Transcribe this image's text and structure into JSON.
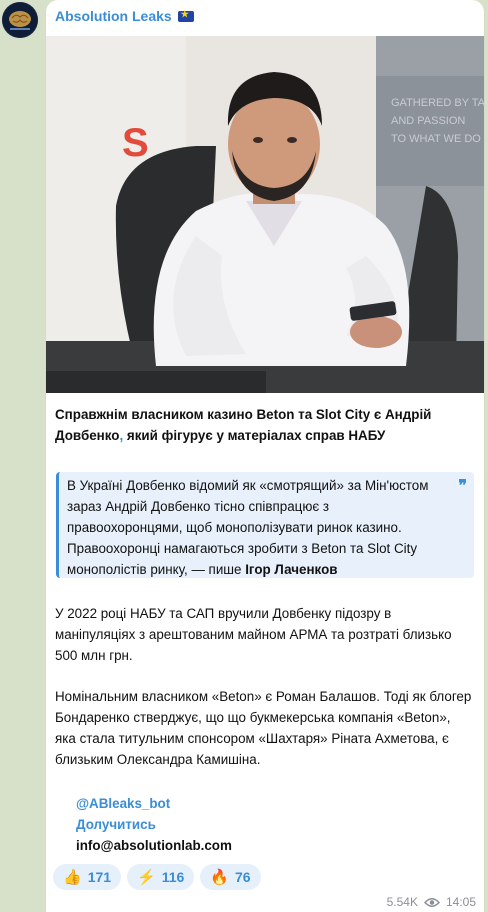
{
  "channel": {
    "name": "Absolution Leaks",
    "flag_icon": "eu-flag-icon",
    "avatar_icon": "brain-logo-icon"
  },
  "photo": {
    "wall_text": [
      "GATHERED BY TAL",
      "AND PASSION",
      "TO WHAT WE DO"
    ],
    "logo_letter": "S"
  },
  "post": {
    "headline_part1": "Справжнім власником казино Beton та Slot City є Андрій Довбенко",
    "headline_comma": ",",
    "headline_part2": " який фігурує у матеріалах справ НАБУ",
    "quote_text": "В Україні Довбенко відомий як «смотрящий» за Мін'юстом зараз Андрій Довбенко тісно співпрацює з правоохоронцями, щоб монополізувати ринок казино. Правоохоронці намагаються зробити з Beton та Slot City монополістів ринку, — пише ",
    "quote_author": "Ігор Лаченков",
    "quote_icon": "quote-mark-icon",
    "paragraph1": "У 2022 році НАБУ та САП вручили Довбенку підозру в маніпуляціях з арештованим майном АРМА та розтраті близько 500 млн грн.",
    "paragraph2": "Номінальним власником «Beton» є Роман Балашов. Тоді як блогер Бондаренко стверджує, що що букмекерська компанія «Beton», яка стала титульним спонсором «Шахтаря» Ріната Ахметова, є близьким Олександра Камишіна.",
    "link_bot": "@ABleaks_bot",
    "link_join": "Долучитись",
    "email": "info@absolutionlab.com"
  },
  "reactions": [
    {
      "emoji": "👍",
      "icon": "thumbs-up-icon",
      "count": "171"
    },
    {
      "emoji": "⚡",
      "icon": "lightning-icon",
      "count": "116"
    },
    {
      "emoji": "🔥",
      "icon": "fire-icon",
      "count": "76"
    }
  ],
  "meta": {
    "views": "5.54K",
    "time": "14:05"
  },
  "colors": {
    "accent": "#3a8dd6",
    "background": "#d7e0c9"
  }
}
